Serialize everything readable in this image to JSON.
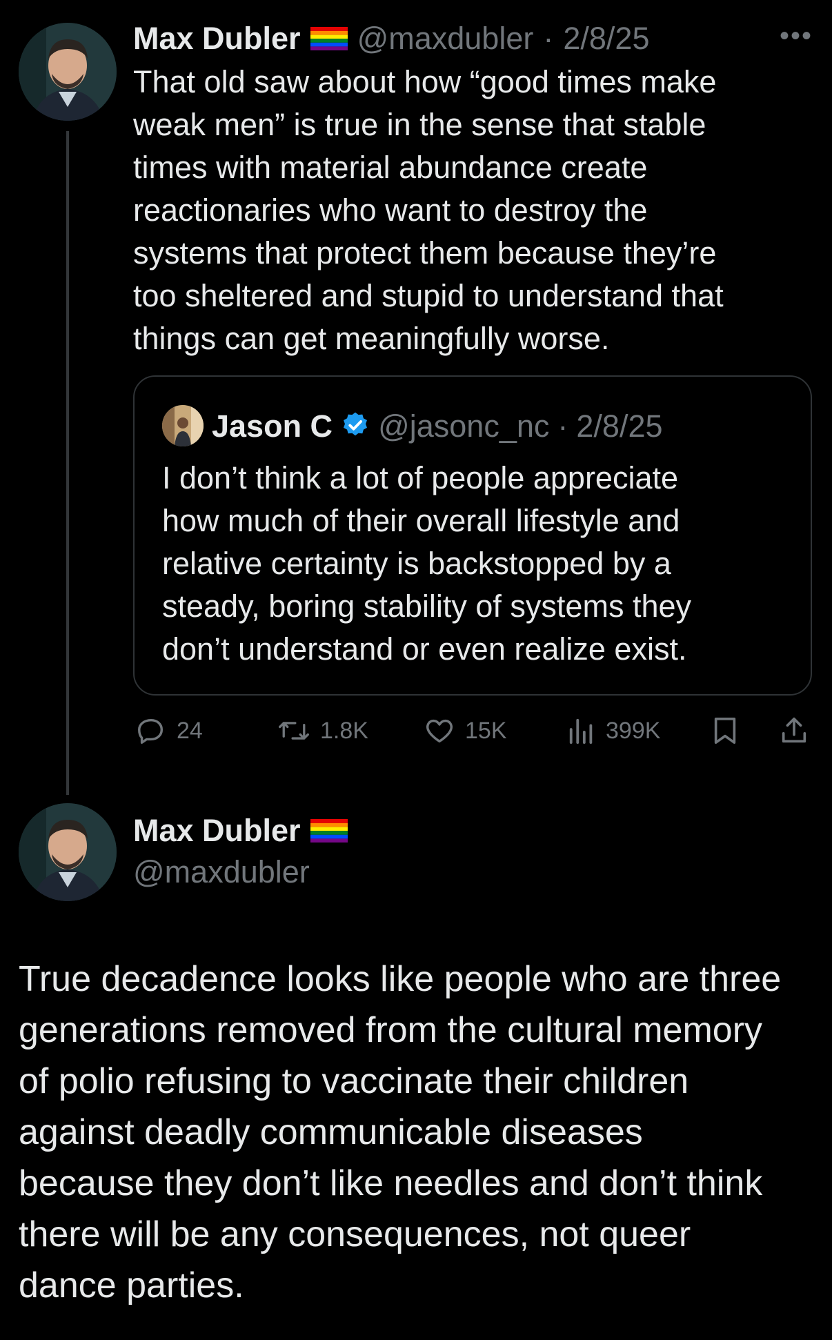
{
  "tweet1": {
    "author_name": "Max Dubler",
    "handle": "@maxdubler",
    "date": "2/8/25",
    "body_lines": [
      "That old saw about how “good times make",
      "weak men” is true in the sense that stable",
      "times with material abundance create",
      "reactionaries who want to destroy the",
      "systems that protect them because they’re",
      "too sheltered and stupid to understand that",
      "things can get meaningfully worse."
    ],
    "quote": {
      "author_name": "Jason C",
      "handle": "@jasonc_nc",
      "date": "2/8/25",
      "body_lines": [
        "I don’t think a lot of people appreciate",
        "how much of their overall lifestyle and",
        "relative certainty is backstopped by a",
        "steady, boring stability of systems they",
        "don’t understand or even realize exist."
      ]
    },
    "actions": {
      "replies": "24",
      "reposts": "1.8K",
      "likes": "15K",
      "views": "399K"
    }
  },
  "tweet2": {
    "author_name": "Max Dubler",
    "handle": "@maxdubler",
    "body_lines": [
      "True decadence looks like people who are three",
      "generations removed from the cultural memory",
      "of polio refusing to vaccinate their children",
      "against deadly communicable diseases",
      "because they don’t like needles and don’t think",
      "there will be any consequences, not queer",
      "dance parties."
    ]
  },
  "colors": {
    "background": "#000000",
    "text": "#e7e9ea",
    "muted": "#71767b",
    "border": "#2f3336",
    "verified": "#1d9bf0"
  },
  "icons": [
    "rainbow-flag-icon",
    "more-icon",
    "verified-badge-icon",
    "reply-icon",
    "repost-icon",
    "like-icon",
    "views-icon",
    "bookmark-icon",
    "share-icon"
  ]
}
